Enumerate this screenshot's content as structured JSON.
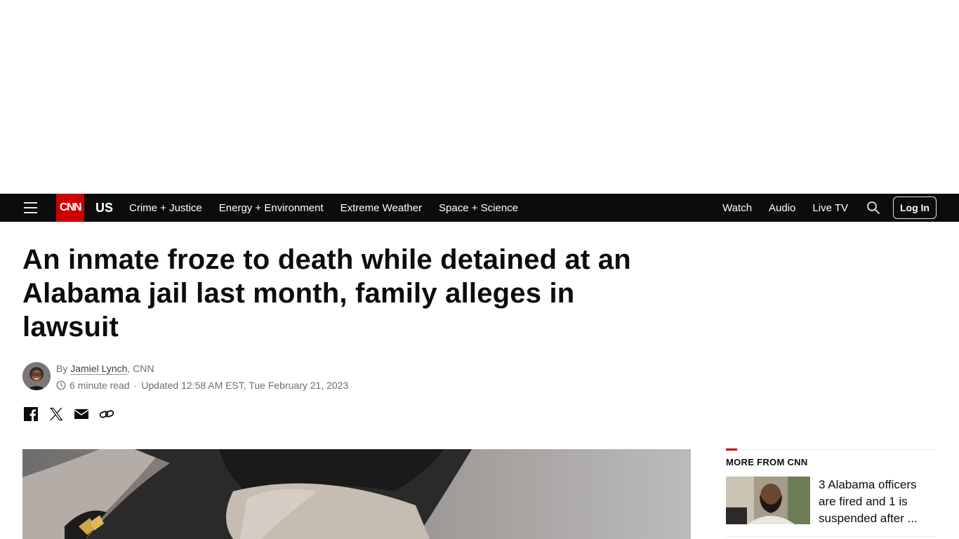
{
  "nav": {
    "logo": "CNN",
    "section": "US",
    "links": [
      "Crime + Justice",
      "Energy + Environment",
      "Extreme Weather",
      "Space + Science"
    ],
    "right_links": [
      "Watch",
      "Audio",
      "Live TV"
    ],
    "login": "Log In"
  },
  "article": {
    "headline": "An inmate froze to death while detained at an Alabama jail last month, family alleges in lawsuit",
    "byline_prefix": "By ",
    "author": "Jamiel Lynch",
    "outlet": ", CNN",
    "read_time": "6 minute read",
    "separator": "·",
    "updated": "Updated 12:58 AM EST, Tue February 21, 2023"
  },
  "share": {
    "icons": [
      "facebook-icon",
      "x-icon",
      "email-icon",
      "link-icon"
    ]
  },
  "rail": {
    "title": "MORE FROM CNN",
    "items": [
      {
        "text": "3 Alabama officers are fired and 1 is suspended after ..."
      }
    ]
  },
  "colors": {
    "nav_bg": "#0c0c0c",
    "brand_red": "#cc0000",
    "text": "#0c0c0c",
    "muted": "#6e6e6e"
  }
}
